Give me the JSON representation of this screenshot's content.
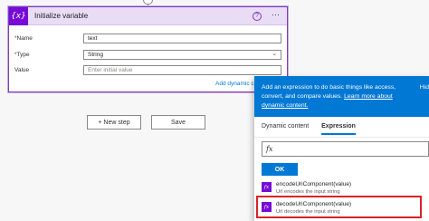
{
  "card": {
    "title": "Initialize variable",
    "icon_label": "{x}",
    "help_icon": "?",
    "more_icon": "···",
    "fields": {
      "name": {
        "required_mark": "*",
        "label": "Name",
        "value": "text"
      },
      "type": {
        "required_mark": "*",
        "label": "Type",
        "value": "String"
      },
      "value": {
        "label": "Value",
        "placeholder": "Enter initial value"
      }
    },
    "add_dynamic": "Add dynamic c"
  },
  "buttons": {
    "new_step": "+ New step",
    "save": "Save"
  },
  "panel": {
    "info_text": "Add an expression to do basic things like access, convert, and compare values.",
    "info_link": "Learn more about dynamic content.",
    "hide_label": "Hid",
    "tabs": [
      "Dynamic content",
      "Expression"
    ],
    "active_tab": "Expression",
    "fx_label": "fx",
    "ok": "OK",
    "functions": [
      {
        "name": "encodeUriComponent(value)",
        "description": "Url encodes the input string"
      },
      {
        "name": "decodeUriComponent(value)",
        "description": "Url decodes the input string"
      }
    ]
  },
  "colors": {
    "accent": "#0078d4",
    "action_purple": "#770bd6",
    "highlight_red": "#d9232a"
  },
  "icons": {
    "variable": "variable-icon",
    "function": "function-icon",
    "help": "help-icon",
    "more": "more-options-icon"
  }
}
